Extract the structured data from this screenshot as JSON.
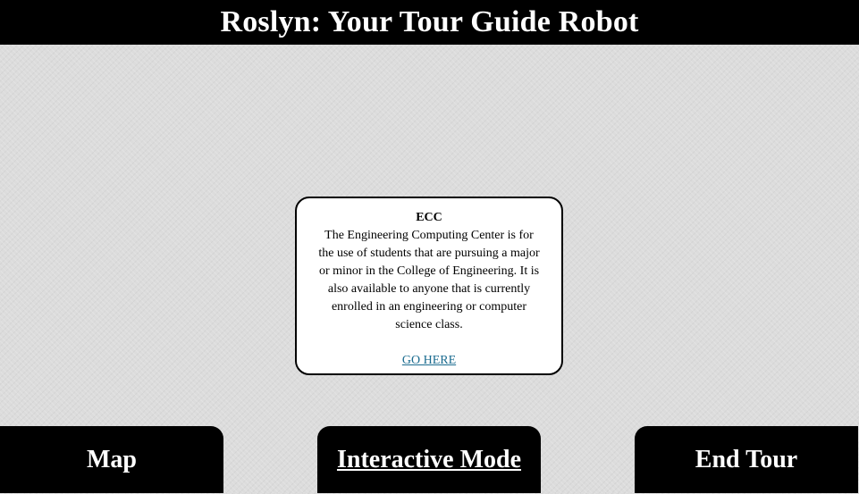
{
  "header": {
    "title": "Roslyn: Your Tour Guide Robot"
  },
  "info_box": {
    "title": "ECC",
    "description": "The Engineering Computing Center is for the use of students that are pursuing a major or minor in the College of Engineering. It is also available to anyone that is currently enrolled in an engineering or computer science class.",
    "link_label": "GO HERE"
  },
  "nav": {
    "map_label": "Map",
    "interactive_label": "Interactive Mode",
    "end_tour_label": "End Tour"
  },
  "colors": {
    "header_bg": "#000000",
    "link": "#1a6b8f",
    "page_bg": "#dcdcdc"
  }
}
